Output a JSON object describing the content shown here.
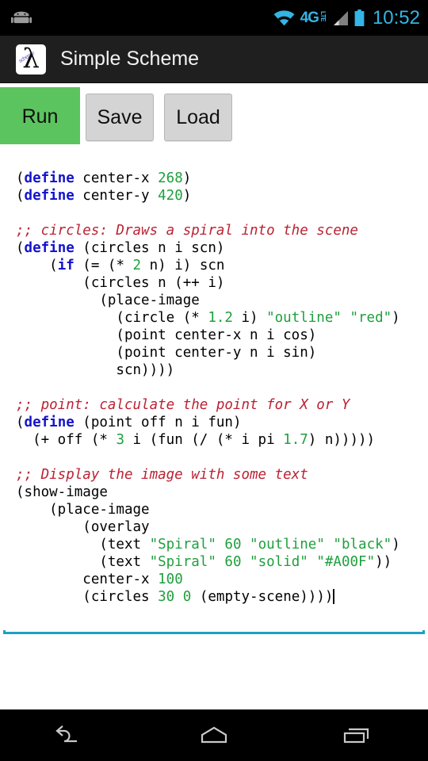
{
  "statusbar": {
    "android_icon": "android-robot-icon",
    "wifi_icon": "wifi-icon",
    "network_label": "4G",
    "network_sub": "LTE",
    "signal_icon": "cellular-signal-icon",
    "battery_icon": "battery-full-icon",
    "time": "10:52"
  },
  "actionbar": {
    "logo_glyph": "λ",
    "logo_ghost": "scheme",
    "title": "Simple Scheme"
  },
  "toolbar": {
    "run_label": "Run",
    "save_label": "Save",
    "load_label": "Load",
    "run_color": "#5cc45f",
    "button_color": "#d4d4d4"
  },
  "editor": {
    "caret_visible": true,
    "underline_color": "#1ba1c4",
    "syntax_colors": {
      "keyword": "#1414cc",
      "number": "#1f9f3d",
      "string": "#1f9f3d",
      "comment": "#bb2233",
      "text": "#000000"
    },
    "lines": [
      [
        {
          "t": "(",
          "c": ""
        },
        {
          "t": "define",
          "c": "kw"
        },
        {
          "t": " center-x ",
          "c": ""
        },
        {
          "t": "268",
          "c": "num"
        },
        {
          "t": ")",
          "c": ""
        }
      ],
      [
        {
          "t": "(",
          "c": ""
        },
        {
          "t": "define",
          "c": "kw"
        },
        {
          "t": " center-y ",
          "c": ""
        },
        {
          "t": "420",
          "c": "num"
        },
        {
          "t": ")",
          "c": ""
        }
      ],
      [],
      [
        {
          "t": ";; circles: Draws a spiral into the scene",
          "c": "cmt"
        }
      ],
      [
        {
          "t": "(",
          "c": ""
        },
        {
          "t": "define",
          "c": "kw"
        },
        {
          "t": " (circles n i scn)",
          "c": ""
        }
      ],
      [
        {
          "t": "    (",
          "c": ""
        },
        {
          "t": "if",
          "c": "kw"
        },
        {
          "t": " (= (* ",
          "c": ""
        },
        {
          "t": "2",
          "c": "num"
        },
        {
          "t": " n) i) scn",
          "c": ""
        }
      ],
      [
        {
          "t": "        (circles n (++ i)",
          "c": ""
        }
      ],
      [
        {
          "t": "          (place-image",
          "c": ""
        }
      ],
      [
        {
          "t": "            (circle (* ",
          "c": ""
        },
        {
          "t": "1.2",
          "c": "num"
        },
        {
          "t": " i) ",
          "c": ""
        },
        {
          "t": "\"outline\"",
          "c": "str"
        },
        {
          "t": " ",
          "c": ""
        },
        {
          "t": "\"red\"",
          "c": "str"
        },
        {
          "t": ")",
          "c": ""
        }
      ],
      [
        {
          "t": "            (point center-x n i cos)",
          "c": ""
        }
      ],
      [
        {
          "t": "            (point center-y n i sin)",
          "c": ""
        }
      ],
      [
        {
          "t": "            scn))))",
          "c": ""
        }
      ],
      [],
      [
        {
          "t": ";; point: calculate the point for X or Y",
          "c": "cmt"
        }
      ],
      [
        {
          "t": "(",
          "c": ""
        },
        {
          "t": "define",
          "c": "kw"
        },
        {
          "t": " (point off n i fun)",
          "c": ""
        }
      ],
      [
        {
          "t": "  (+ off (* ",
          "c": ""
        },
        {
          "t": "3",
          "c": "num"
        },
        {
          "t": " i (fun (/ (* i pi ",
          "c": ""
        },
        {
          "t": "1.7",
          "c": "num"
        },
        {
          "t": ") n)))))",
          "c": ""
        }
      ],
      [],
      [
        {
          "t": ";; Display the image with some text",
          "c": "cmt"
        }
      ],
      [
        {
          "t": "(show-image",
          "c": ""
        }
      ],
      [
        {
          "t": "    (place-image",
          "c": ""
        }
      ],
      [
        {
          "t": "        (overlay",
          "c": ""
        }
      ],
      [
        {
          "t": "          (text ",
          "c": ""
        },
        {
          "t": "\"Spiral\"",
          "c": "str"
        },
        {
          "t": " ",
          "c": ""
        },
        {
          "t": "60",
          "c": "num"
        },
        {
          "t": " ",
          "c": ""
        },
        {
          "t": "\"outline\"",
          "c": "str"
        },
        {
          "t": " ",
          "c": ""
        },
        {
          "t": "\"black\"",
          "c": "str"
        },
        {
          "t": ")",
          "c": ""
        }
      ],
      [
        {
          "t": "          (text ",
          "c": ""
        },
        {
          "t": "\"Spiral\"",
          "c": "str"
        },
        {
          "t": " ",
          "c": ""
        },
        {
          "t": "60",
          "c": "num"
        },
        {
          "t": " ",
          "c": ""
        },
        {
          "t": "\"solid\"",
          "c": "str"
        },
        {
          "t": " ",
          "c": ""
        },
        {
          "t": "\"#A00F\"",
          "c": "str"
        },
        {
          "t": "))",
          "c": ""
        }
      ],
      [
        {
          "t": "        center-x ",
          "c": ""
        },
        {
          "t": "100",
          "c": "num"
        }
      ],
      [
        {
          "t": "        (circles ",
          "c": ""
        },
        {
          "t": "30",
          "c": "num"
        },
        {
          "t": " ",
          "c": ""
        },
        {
          "t": "0",
          "c": "num"
        },
        {
          "t": " (empty-scene))))",
          "c": ""
        },
        {
          "t": "|CARET|",
          "c": "caret"
        }
      ]
    ]
  },
  "navbar": {
    "back_label": "back-button",
    "home_label": "home-button",
    "recents_label": "recents-button"
  }
}
